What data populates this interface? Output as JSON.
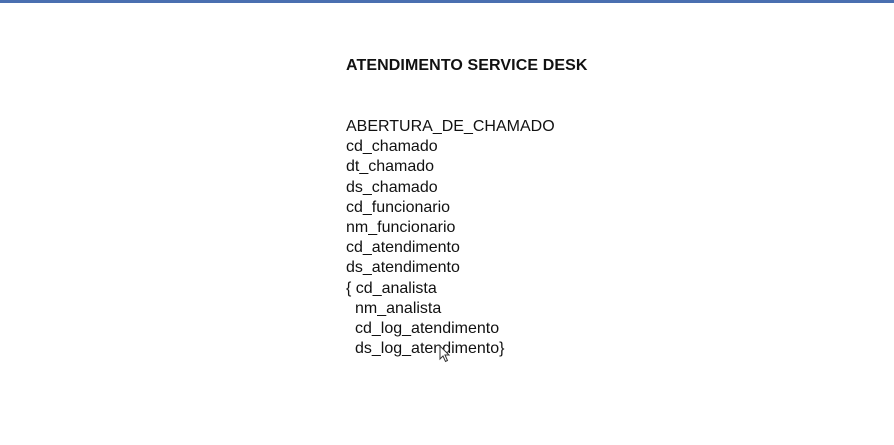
{
  "document": {
    "title": "ATENDIMENTO SERVICE DESK",
    "entity": "ABERTURA_DE_CHAMADO",
    "fields": [
      "cd_chamado",
      "dt_chamado",
      "ds_chamado",
      "cd_funcionario",
      "nm_funcionario",
      "cd_atendimento",
      "ds_atendimento"
    ],
    "group_open": "{ cd_analista",
    "group_fields": [
      "nm_analista",
      "cd_log_atendimento",
      "ds_log_atendimento}"
    ]
  },
  "cursor": {
    "icon": "mouse-pointer-icon"
  },
  "colors": {
    "top_border": "#4a6fb0",
    "text": "#111111"
  }
}
